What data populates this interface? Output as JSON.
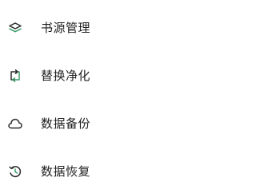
{
  "menu": {
    "items": [
      {
        "label": "书源管理",
        "icon": "layers-icon",
        "accent": "#3a9e6a"
      },
      {
        "label": "替换净化",
        "icon": "swap-icon",
        "accent": "#3a9e6a"
      },
      {
        "label": "数据备份",
        "icon": "cloud-icon",
        "accent": "#3a9e6a"
      },
      {
        "label": "数据恢复",
        "icon": "history-icon",
        "accent": "#3a9e6a"
      }
    ]
  },
  "colors": {
    "icon_dark": "#2b2b2b",
    "icon_accent": "#3a9e6a",
    "text": "#1f1f1f",
    "background": "#ffffff"
  }
}
